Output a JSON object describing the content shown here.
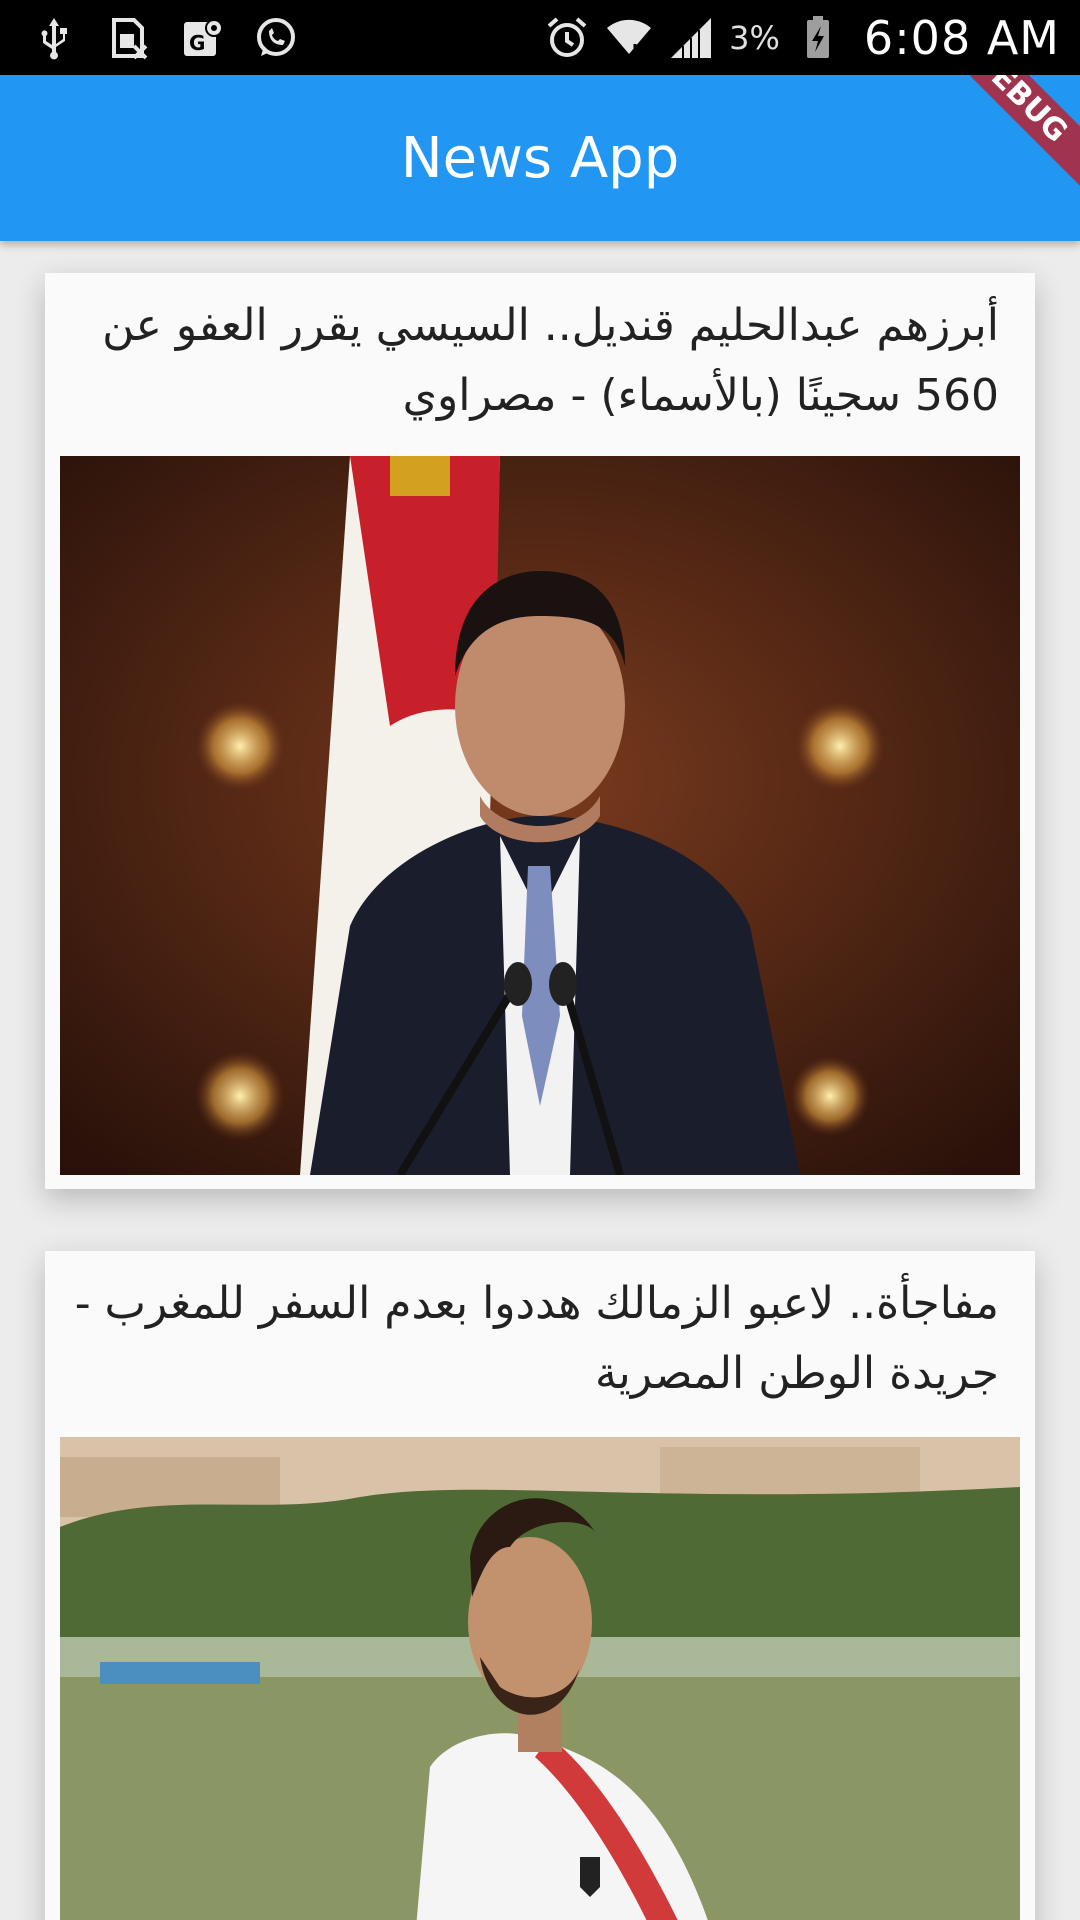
{
  "status_bar": {
    "left_icons": [
      "usb-icon",
      "sim-card-icon",
      "maps-icon",
      "whatsapp-icon"
    ],
    "right_icons": [
      "alarm-icon",
      "wifi-icon",
      "signal-icon",
      "battery-icon"
    ],
    "battery": "3%",
    "time": "6:08 AM"
  },
  "app_bar": {
    "title": "News App",
    "debug_banner": "DEBUG",
    "color": "#2196f3"
  },
  "articles": [
    {
      "title": "أبرزهم عبدالحليم قنديل.. السيسي يقرر العفو عن 560 سجينًا (بالأسماء) - مصراوي",
      "image": "photo of a man in a dark suit at a podium with two microphones, in front of a red white and black flag"
    },
    {
      "title": "مفاجأة.. لاعبو الزمالك هددوا بعدم السفر للمغرب - جريدة الوطن المصرية",
      "image": "photo of a bearded football player in a white jersey with a red stripe on a training field"
    }
  ]
}
